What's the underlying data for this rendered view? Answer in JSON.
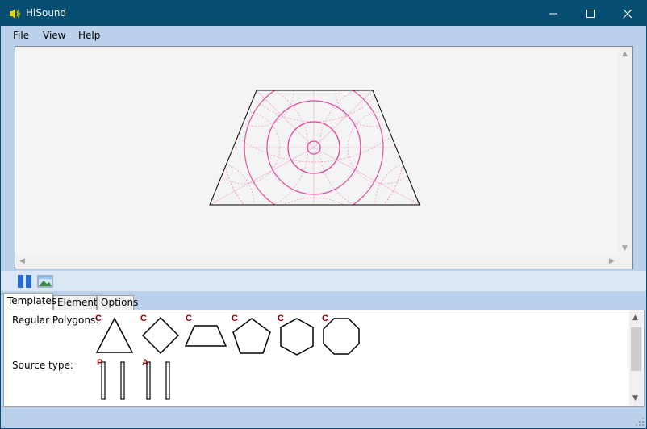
{
  "window": {
    "title": "HiSound",
    "icon": "speaker-icon",
    "controls": [
      "minimize-icon",
      "maximize-icon",
      "close-icon"
    ]
  },
  "menu": [
    {
      "label": "File"
    },
    {
      "label": "View"
    },
    {
      "label": "Help"
    }
  ],
  "toolbar": {
    "icons": [
      "pause-icon",
      "image-icon"
    ]
  },
  "tabs": [
    {
      "label": "Templates",
      "active": true
    },
    {
      "label": "Elements",
      "active": false
    },
    {
      "label": "Options",
      "active": false
    }
  ],
  "templates": {
    "regular_polygons": {
      "label": "Regular Polygons:",
      "items": [
        {
          "tag": "C",
          "sides": 3
        },
        {
          "tag": "C",
          "sides": 4
        },
        {
          "tag": "C",
          "shape": "trapezoid"
        },
        {
          "tag": "C",
          "sides": 5
        },
        {
          "tag": "C",
          "sides": 6
        },
        {
          "tag": "C",
          "sides": 8
        }
      ]
    },
    "source_type": {
      "label": "Source type:",
      "items": [
        {
          "tag": "P"
        },
        {
          "tag": "A"
        }
      ]
    }
  },
  "colors": {
    "titlebar": "#064d72",
    "chrome": "#b9d1ea",
    "wave": "#e8409a",
    "tag": "#8b0000"
  }
}
